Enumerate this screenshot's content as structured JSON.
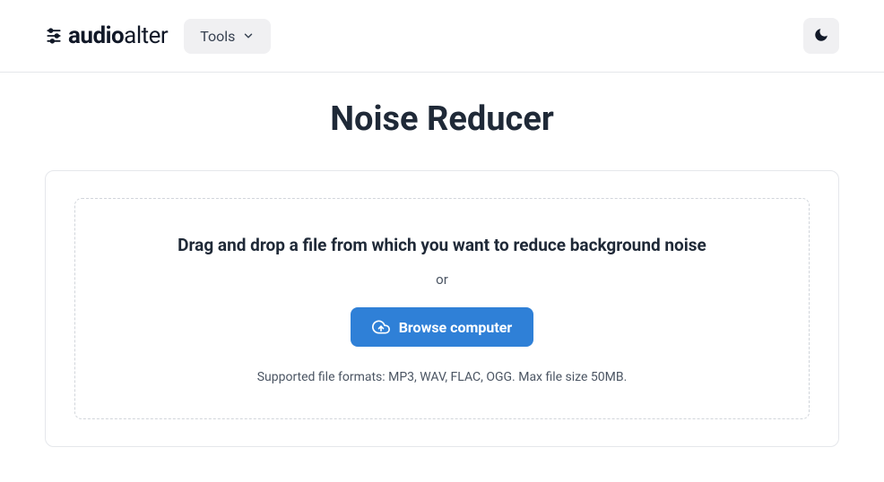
{
  "brand": {
    "name_part1": "audio",
    "name_part2": "alter"
  },
  "nav": {
    "tools_label": "Tools"
  },
  "page": {
    "title": "Noise Reducer"
  },
  "dropzone": {
    "instruction": "Drag and drop a file from which you want to reduce background noise",
    "or_label": "or",
    "browse_label": "Browse computer",
    "supported": "Supported file formats: MP3, WAV, FLAC, OGG. Max file size 50MB."
  }
}
